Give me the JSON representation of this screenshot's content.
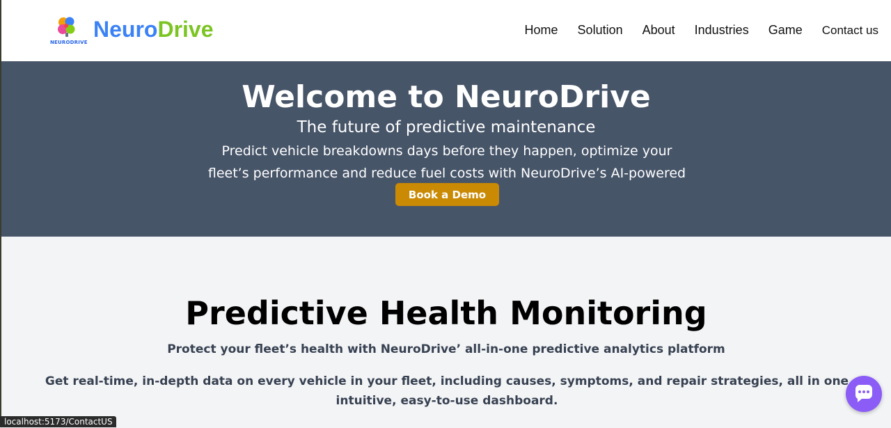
{
  "brand": {
    "logo_mark_text": "NEURODRIVE",
    "name_part1": "Neuro",
    "name_part2": "Drive",
    "colors": {
      "neuro": "#3b82f6",
      "drive": "#7cc423"
    }
  },
  "nav": {
    "items": [
      {
        "label": "Home"
      },
      {
        "label": "Solution"
      },
      {
        "label": "About"
      },
      {
        "label": "Industries"
      },
      {
        "label": "Game"
      },
      {
        "label": "Contact us"
      }
    ]
  },
  "hero": {
    "title": "Welcome to NeuroDrive",
    "subtitle": "The future of predictive maintenance",
    "description": "Predict vehicle breakdowns days before they happen, optimize your fleet’s performance and reduce fuel costs with NeuroDrive’s AI-powered platform.",
    "cta_label": "Book a Demo",
    "background_color": "#475569",
    "cta_color": "#ca8a04"
  },
  "monitoring": {
    "title": "Predictive Health Monitoring",
    "lead": "Protect your fleet’s health with NeuroDrive’ all-in-one predictive analytics platform",
    "body": "Get real-time, in-depth data on every vehicle in your fleet, including causes, symptoms, and repair strategies, all in one intuitive, easy-to-use dashboard."
  },
  "chat": {
    "icon": "chat-bubble-icon",
    "color": "#8b5cf6"
  },
  "status_bar": {
    "url": "localhost:5173/ContactUS"
  }
}
